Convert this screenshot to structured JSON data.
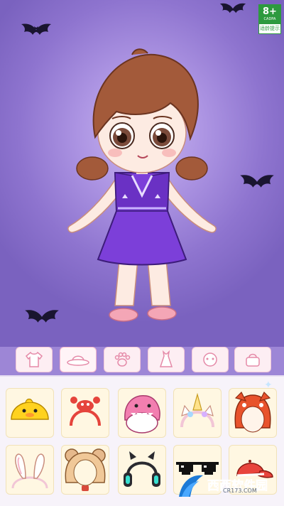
{
  "age_rating": {
    "label": "8+",
    "code": "CADPA",
    "note": "适龄提示",
    "color": "#2d9a3e"
  },
  "character": {
    "hair_color": "#a35a3a",
    "dress_color": "#7c3fd9",
    "shoe_color": "#f4a6b6"
  },
  "tabs": [
    {
      "icon": "shirt-icon"
    },
    {
      "icon": "hat-icon"
    },
    {
      "icon": "paw-icon"
    },
    {
      "icon": "dress-icon"
    },
    {
      "icon": "face-icon"
    },
    {
      "icon": "bag-icon"
    }
  ],
  "items": [
    {
      "icon": "duck-hat-icon"
    },
    {
      "icon": "crab-headband-icon"
    },
    {
      "icon": "shark-hood-icon"
    },
    {
      "icon": "unicorn-headband-icon"
    },
    {
      "icon": "red-panda-hood-icon"
    },
    {
      "icon": "bunny-ears-icon"
    },
    {
      "icon": "bear-hood-icon"
    },
    {
      "icon": "cat-headphones-icon"
    },
    {
      "icon": "pixel-sunglasses-icon"
    },
    {
      "icon": "red-cap-icon"
    }
  ],
  "watermark": {
    "brand": "西西软件园",
    "domain": "CR173.COM"
  }
}
